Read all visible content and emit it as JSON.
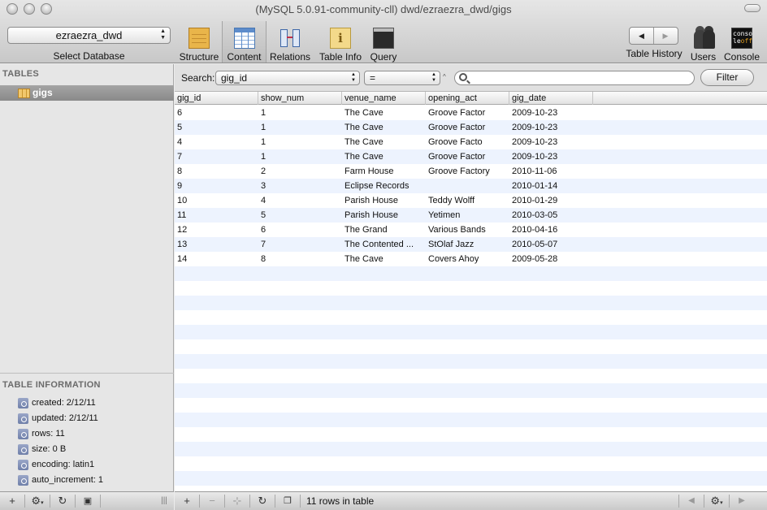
{
  "window": {
    "title": "(MySQL 5.0.91-community-cll) dwd/ezraezra_dwd/gigs"
  },
  "toolbar": {
    "database_value": "ezraezra_dwd",
    "database_caption": "Select Database",
    "buttons": {
      "structure": "Structure",
      "content": "Content",
      "relations": "Relations",
      "table_info": "Table Info",
      "query": "Query",
      "table_history": "Table History",
      "users": "Users",
      "console": "Console"
    },
    "console_icon_text": [
      "conso",
      "le",
      "off"
    ]
  },
  "sidebar": {
    "tables_heading": "TABLES",
    "tables": [
      {
        "name": "gigs",
        "icon": "table-icon"
      }
    ],
    "info_heading": "TABLE INFORMATION",
    "info": [
      "created: 2/12/11",
      "updated: 2/12/11",
      "rows: 11",
      "size: 0 B",
      "encoding: latin1",
      "auto_increment: 1"
    ]
  },
  "filter": {
    "search_label": "Search:",
    "field": "gig_id",
    "operator": "=",
    "query": "",
    "button": "Filter"
  },
  "table": {
    "columns": [
      "gig_id",
      "show_num",
      "venue_name",
      "opening_act",
      "gig_date"
    ],
    "rows": [
      [
        "6",
        "1",
        "The Cave",
        "Groove Factor",
        "2009-10-23"
      ],
      [
        "5",
        "1",
        "The Cave",
        "Groove Factor",
        "2009-10-23"
      ],
      [
        "4",
        "1",
        "The Cave",
        "Groove Facto",
        "2009-10-23"
      ],
      [
        "7",
        "1",
        "The Cave",
        "Groove Factor",
        "2009-10-23"
      ],
      [
        "8",
        "2",
        "Farm House",
        "Groove Factory",
        "2010-11-06"
      ],
      [
        "9",
        "3",
        "Eclipse Records",
        "",
        "2010-01-14"
      ],
      [
        "10",
        "4",
        "Parish House",
        "Teddy Wolff",
        "2010-01-29"
      ],
      [
        "11",
        "5",
        "Parish House",
        "Yetimen",
        "2010-03-05"
      ],
      [
        "12",
        "6",
        "The Grand",
        "Various Bands",
        "2010-04-16"
      ],
      [
        "13",
        "7",
        "The Contented ...",
        "StOlaf Jazz",
        "2010-05-07"
      ],
      [
        "14",
        "8",
        "The Cave",
        "Covers Ahoy",
        "2009-05-28"
      ]
    ]
  },
  "status": {
    "rows_in_table": "11 rows in table"
  },
  "icons": {
    "bottom_left": [
      "plus-icon",
      "gear-icon",
      "refresh-icon",
      "show-info-icon",
      "split-handle-icon"
    ],
    "bottom_right": [
      "plus-icon",
      "minus-icon",
      "duplicate-icon",
      "refresh-icon",
      "copy-sql-icon",
      "prev-page-icon",
      "gear-icon",
      "next-page-icon"
    ]
  },
  "colors": {
    "row_stripe": "#edf3fe",
    "selected_table": "#8a8a8a"
  }
}
